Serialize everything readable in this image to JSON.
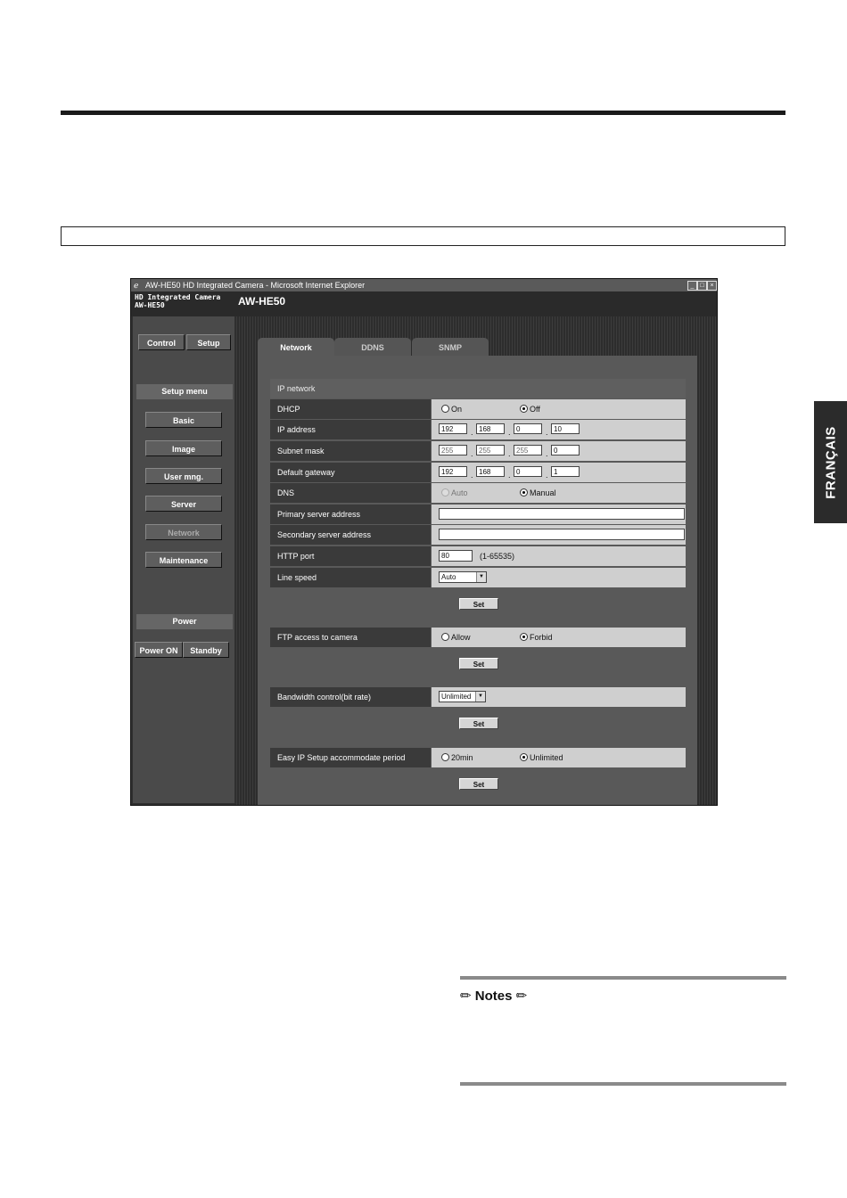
{
  "side_tab": "FRANÇAIS",
  "window": {
    "title": "AW-HE50 HD Integrated Camera - Microsoft Internet Explorer",
    "buttons": [
      "_",
      "□",
      "×"
    ]
  },
  "app": {
    "brand_line1": "HD Integrated Camera",
    "brand_line2": "AW-HE50",
    "model": "AW-HE50",
    "top_buttons": [
      "Control",
      "Setup"
    ],
    "setup_menu_label": "Setup menu",
    "menu": [
      "Basic",
      "Image",
      "User mng.",
      "Server",
      "Network",
      "Maintenance"
    ],
    "power_label": "Power",
    "power_buttons": [
      "Power ON",
      "Standby"
    ]
  },
  "tabs": [
    "Network",
    "DDNS",
    "SNMP"
  ],
  "form": {
    "section_ip": "IP network",
    "dhcp": {
      "label": "DHCP",
      "on": "On",
      "off": "Off"
    },
    "ip_address": {
      "label": "IP address",
      "octets": [
        "192",
        "168",
        "0",
        "10"
      ]
    },
    "subnet_mask": {
      "label": "Subnet mask",
      "octets": [
        "255",
        "255",
        "255",
        "0"
      ]
    },
    "default_gateway": {
      "label": "Default gateway",
      "octets": [
        "192",
        "168",
        "0",
        "1"
      ]
    },
    "dns": {
      "label": "DNS",
      "auto": "Auto",
      "manual": "Manual"
    },
    "primary_dns": {
      "label": "Primary server address",
      "value": ""
    },
    "secondary_dns": {
      "label": "Secondary server address",
      "value": ""
    },
    "http_port": {
      "label": "HTTP port",
      "value": "80",
      "hint": "(1-65535)"
    },
    "line_speed": {
      "label": "Line speed",
      "value": "Auto"
    },
    "set_label": "Set",
    "ftp": {
      "label": "FTP access to camera",
      "allow": "Allow",
      "forbid": "Forbid"
    },
    "bandwidth": {
      "label": "Bandwidth control(bit rate)",
      "value": "Unlimited"
    },
    "easy_ip": {
      "label": "Easy IP Setup accommodate period",
      "opt1": "20min",
      "opt2": "Unlimited"
    }
  },
  "notes": {
    "title": "Notes",
    "pencil": "✏"
  }
}
